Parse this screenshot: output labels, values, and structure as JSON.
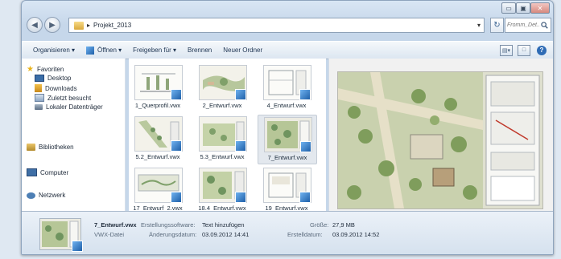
{
  "window": {
    "min": "▭",
    "max": "▣",
    "close": "✕"
  },
  "address": {
    "arrow": "▸",
    "path": "Projekt_2013",
    "dropdown": "▾",
    "refresh": "↻"
  },
  "search": {
    "placeholder": "Fromm_Det...",
    "icon": "search-icon"
  },
  "toolbar": {
    "organize": "Organisieren ▾",
    "open": "Öffnen ▾",
    "share": "Freigeben für ▾",
    "burn": "Brennen",
    "new_folder": "Neuer Ordner"
  },
  "nav": {
    "favorites": "Favoriten",
    "desktop": "Desktop",
    "downloads": "Downloads",
    "recent": "Zuletzt besucht",
    "local": "Lokaler Datenträger",
    "libraries": "Bibliotheken",
    "computer": "Computer",
    "network": "Netzwerk"
  },
  "files": [
    {
      "name": "1_Querprofil.vwx"
    },
    {
      "name": "2_Entwurf.vwx"
    },
    {
      "name": "4_Entwurf.vwx"
    },
    {
      "name": "5.2_Entwurf.vwx"
    },
    {
      "name": "5.3_Entwurf.vwx"
    },
    {
      "name": "7_Entwurf.vwx"
    },
    {
      "name": "17_Entwurf_2.vwx"
    },
    {
      "name": "18.4_Entwurf.vwx"
    },
    {
      "name": "19_Entwurf.vwx"
    }
  ],
  "details": {
    "filename": "7_Entwurf.vwx",
    "type": "VWX-Datei",
    "software_label": "Erstellungssoftware:",
    "software_value": "Text hinzufügen",
    "modified_label": "Änderungsdatum:",
    "modified_value": "03.09.2012 14:41",
    "size_label": "Größe:",
    "size_value": "27,9 MB",
    "created_label": "Erstelldatum:",
    "created_value": "03.09.2012 14:52"
  },
  "colors": {
    "accent": "#1e5fa8",
    "selection": "#e3e8ee"
  }
}
